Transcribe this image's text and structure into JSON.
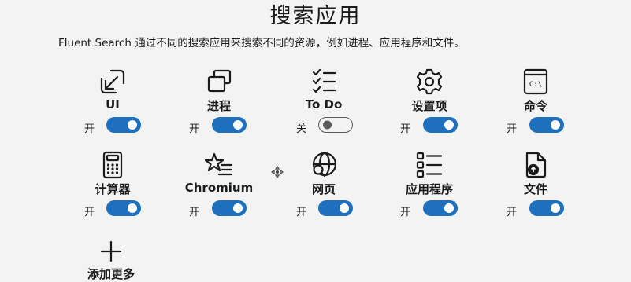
{
  "page": {
    "title": "搜索应用",
    "description": "Fluent Search 通过不同的搜索应用来搜索不同的资源，例如进程、应用程序和文件。"
  },
  "apps": [
    {
      "label": "UI",
      "icon": "ui-arrow-icon",
      "state": "开",
      "enabled": true
    },
    {
      "label": "进程",
      "icon": "processes-icon",
      "state": "开",
      "enabled": true
    },
    {
      "label": "To Do",
      "icon": "todo-list-icon",
      "state": "关",
      "enabled": false
    },
    {
      "label": "设置项",
      "icon": "gear-icon",
      "state": "开",
      "enabled": true
    },
    {
      "label": "命令",
      "icon": "command-prompt-icon",
      "state": "开",
      "enabled": true
    },
    {
      "label": "计算器",
      "icon": "calculator-icon",
      "state": "开",
      "enabled": true
    },
    {
      "label": "Chromium",
      "icon": "star-list-icon",
      "state": "开",
      "enabled": true
    },
    {
      "label": "网页",
      "icon": "web-search-icon",
      "state": "开",
      "enabled": true
    },
    {
      "label": "应用程序",
      "icon": "app-list-icon",
      "state": "开",
      "enabled": true
    },
    {
      "label": "文件",
      "icon": "file-icon",
      "state": "开",
      "enabled": true
    }
  ],
  "add_more": {
    "label": "添加更多",
    "icon": "plus-icon"
  },
  "colors": {
    "toggle_on": "#1f6fbf",
    "background": "#f3f3f3"
  }
}
